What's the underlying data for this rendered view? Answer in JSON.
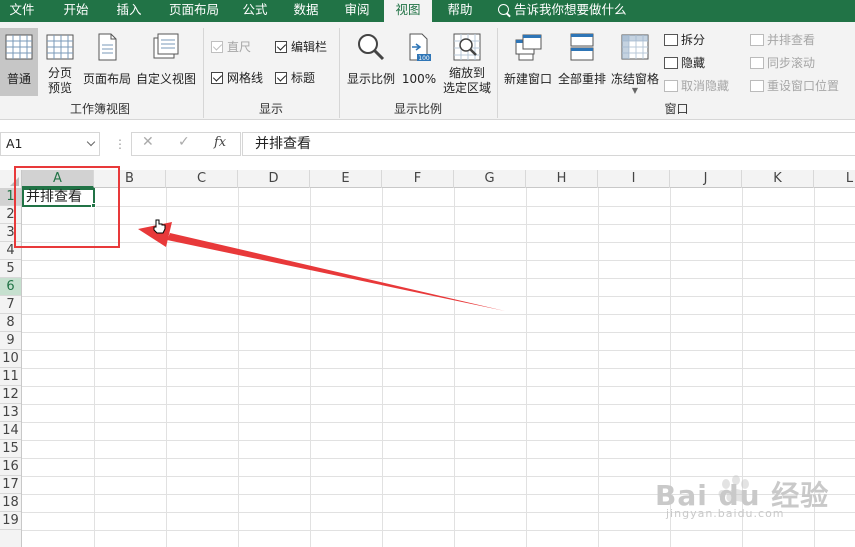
{
  "tabs": [
    {
      "label": "文件",
      "active": false
    },
    {
      "label": "开始",
      "active": false
    },
    {
      "label": "插入",
      "active": false
    },
    {
      "label": "页面布局",
      "active": false
    },
    {
      "label": "公式",
      "active": false
    },
    {
      "label": "数据",
      "active": false
    },
    {
      "label": "审阅",
      "active": false
    },
    {
      "label": "视图",
      "active": true
    },
    {
      "label": "帮助",
      "active": false
    }
  ],
  "tell_me": "告诉我你想要做什么",
  "ribbon": {
    "workbook_views": {
      "label": "工作簿视图",
      "normal": "普通",
      "page_break_1": "分页",
      "page_break_2": "预览",
      "page_layout": "页面布局",
      "custom_views": "自定义视图"
    },
    "show": {
      "label": "显示",
      "ruler": "直尺",
      "formula_bar": "编辑栏",
      "gridlines": "网格线",
      "headings": "标题"
    },
    "zoom": {
      "label": "显示比例",
      "zoom": "显示比例",
      "hundred": "100%",
      "zoom_sel_1": "缩放到",
      "zoom_sel_2": "选定区域"
    },
    "window": {
      "label": "窗口",
      "new_window": "新建窗口",
      "arrange_all": "全部重排",
      "freeze_panes": "冻结窗格",
      "split": "拆分",
      "hide": "隐藏",
      "unhide": "取消隐藏",
      "side_by_side": "并排查看",
      "sync_scroll": "同步滚动",
      "reset_position": "重设窗口位置"
    }
  },
  "formula_bar": {
    "name_box": "A1",
    "cancel": "✕",
    "enter": "✓",
    "fx": "fx",
    "content": "并排查看"
  },
  "grid": {
    "columns": [
      "A",
      "B",
      "C",
      "D",
      "E",
      "F",
      "G",
      "H",
      "I",
      "J",
      "K",
      "L"
    ],
    "rows": [
      "1",
      "2",
      "3",
      "4",
      "5",
      "6",
      "7",
      "8",
      "9",
      "10",
      "11",
      "12",
      "13",
      "14",
      "15",
      "16",
      "17",
      "18",
      "19"
    ],
    "cell_a1": "并排查看"
  },
  "watermark": {
    "brand": "Bai du 经验",
    "url": "jingyan.baidu.com"
  },
  "colors": {
    "accent": "#217346",
    "annotation": "#e8393a"
  }
}
